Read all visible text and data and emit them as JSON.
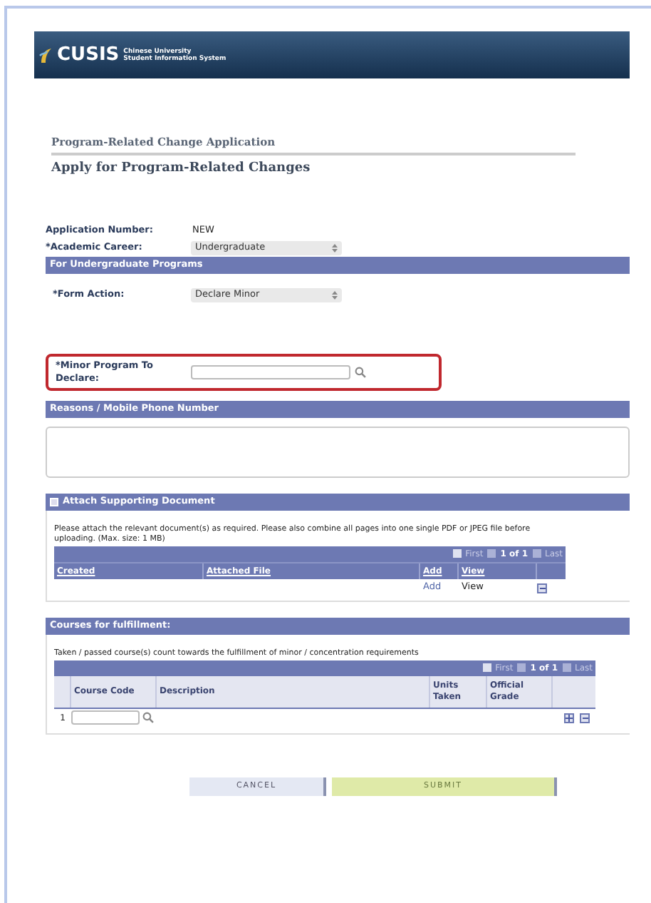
{
  "header": {
    "logo": "CUSIS",
    "subtitle_1": "Chinese University",
    "subtitle_2": "Student Information System"
  },
  "page": {
    "breadcrumb": "Program-Related Change Application",
    "title": "Apply for Program-Related Changes"
  },
  "fields": [
    {
      "label": "Application Number:",
      "kind": "text",
      "value": "NEW"
    },
    {
      "label": "*Academic Career:",
      "kind": "select",
      "value": "Undergraduate"
    }
  ],
  "undergraduate": {
    "title": "For Undergraduate Programs",
    "form_action": {
      "label": "*Form Action:",
      "value": "Declare Minor"
    },
    "minor": {
      "label": "*Minor Program To Declare:",
      "highlighted": true
    }
  },
  "reasons": {
    "title": "Reasons / Mobile Phone Number"
  },
  "attach": {
    "title": "Attach Supporting Document",
    "note": "Please attach the relevant document(s) as required. Please also combine all pages into one single PDF or JPEG file before uploading. (Max. size: 1 MB)",
    "nav": {
      "first": "First",
      "range": "1 of 1",
      "last": "Last"
    },
    "columns": [
      "Created",
      "Attached File",
      "Add",
      "View"
    ],
    "rows": [
      {
        "add": "Add",
        "view": "View"
      }
    ]
  },
  "courses": {
    "title": "Courses for fulfillment:",
    "note": "Taken / passed course(s) count towards the fulfillment of minor / concentration requirements",
    "nav": {
      "first": "First",
      "range": "1 of 1",
      "last": "Last"
    },
    "columns": [
      "Course Code",
      "Description",
      "Units Taken",
      "Official Grade"
    ],
    "rows": [
      {
        "number": "1"
      }
    ]
  },
  "buttons": [
    {
      "label": "CANCEL",
      "kind": "cancel"
    },
    {
      "label": "SUBMIT",
      "kind": "submit"
    }
  ]
}
